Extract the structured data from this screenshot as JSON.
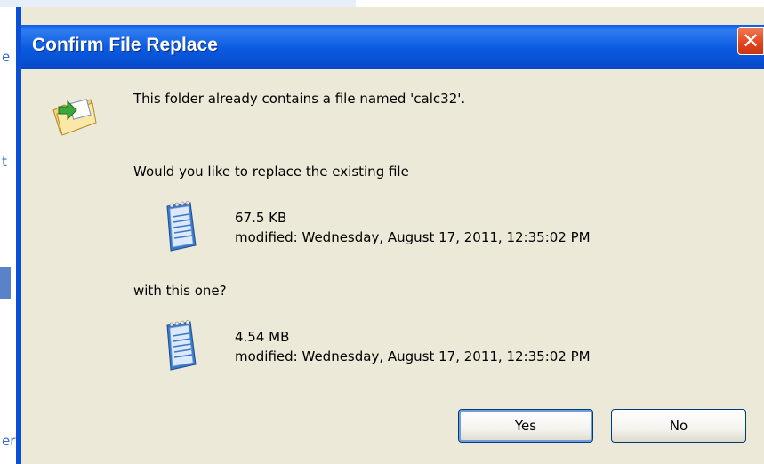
{
  "dialog": {
    "title": "Confirm File Replace",
    "message": "This folder already contains a file named 'calc32'.",
    "question": "Would you like to replace the existing file",
    "existing_file": {
      "size": "67.5 KB",
      "modified": "modified: Wednesday, August 17, 2011, 12:35:02 PM"
    },
    "with_label": "with this one?",
    "new_file": {
      "size": "4.54 MB",
      "modified": "modified: Wednesday, August 17, 2011, 12:35:02 PM"
    },
    "buttons": {
      "yes": "Yes",
      "no": "No"
    },
    "close_glyph": "✕"
  },
  "background": {
    "letters": [
      "e",
      "t",
      "er"
    ]
  },
  "colors": {
    "titlebar": "#0a5ae0",
    "dialog_bg": "#ece9d8",
    "close": "#e0431c"
  },
  "icons": [
    "folder-replace-icon",
    "notepad-file-icon"
  ]
}
